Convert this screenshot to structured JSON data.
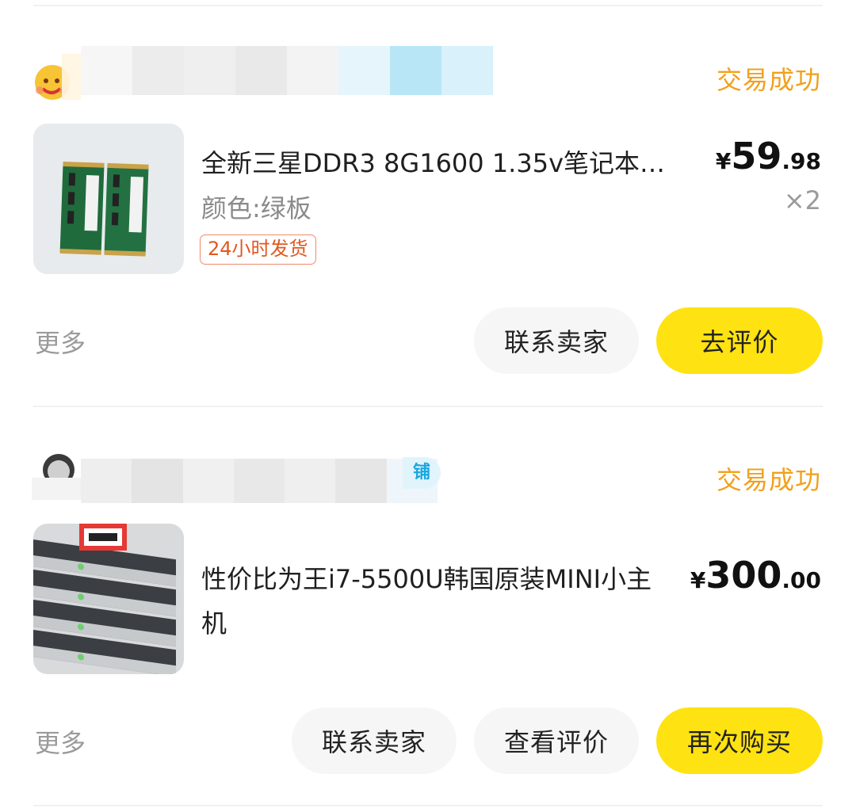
{
  "orders": [
    {
      "status": "交易成功",
      "product": {
        "title": "全新三星DDR3 8G1600 1.35v笔记本…",
        "spec": "颜色:绿板",
        "tag": "24小时发货",
        "price_symbol": "¥",
        "price_int": "59",
        "price_dec": ".98",
        "quantity": "×2"
      },
      "more_label": "更多",
      "buttons": [
        {
          "label": "联系卖家",
          "style": "grey"
        },
        {
          "label": "去评价",
          "style": "yellow"
        }
      ]
    },
    {
      "status": "交易成功",
      "product": {
        "title": "性价比为王i7-5500U韩国原装MINI小主机",
        "price_symbol": "¥",
        "price_int": "300",
        "price_dec": ".00"
      },
      "more_label": "更多",
      "buttons": [
        {
          "label": "联系卖家",
          "style": "grey"
        },
        {
          "label": "查看评价",
          "style": "grey"
        },
        {
          "label": "再次购买",
          "style": "yellow"
        }
      ]
    }
  ],
  "colors": {
    "status": "#f2a01c",
    "primary_button": "#ffe211",
    "secondary_button": "#f6f6f6",
    "tag_text": "#e2571f"
  }
}
